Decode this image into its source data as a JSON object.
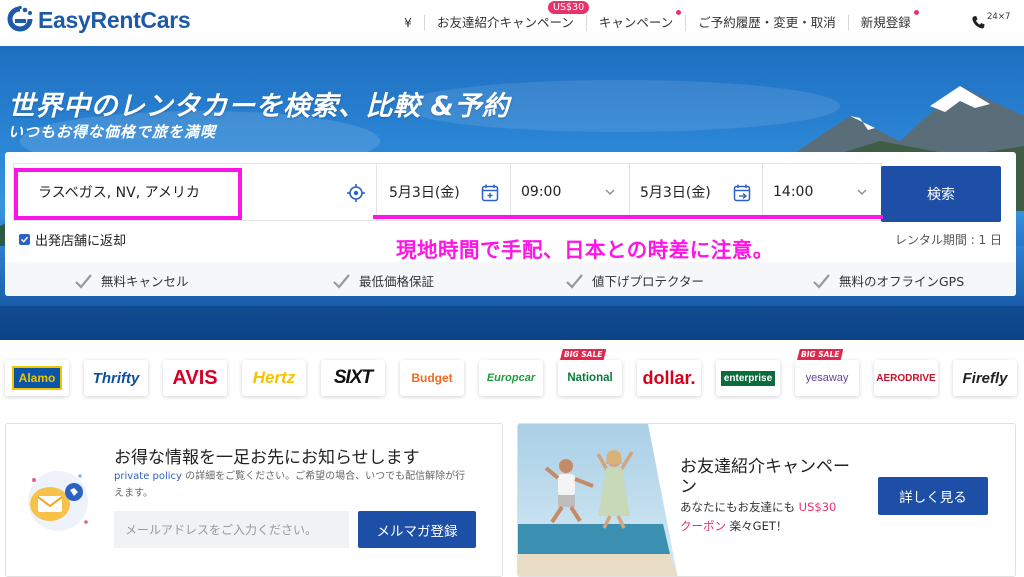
{
  "header": {
    "logo_text": "EasyRentCars",
    "nav": [
      {
        "label": "¥"
      },
      {
        "label": "お友達紹介キャンペーン"
      },
      {
        "label": "キャンペーン"
      },
      {
        "label": "ご予約履歴・変更・取消"
      },
      {
        "label": "新規登録"
      }
    ],
    "referral_badge": "US$30",
    "phone_label": "24×7"
  },
  "hero": {
    "title": "世界中のレンタカーを検索、比較 &予約",
    "subtitle": "いつもお得な価格で旅を満喫"
  },
  "search": {
    "location": "ラスベガス, NV, アメリカ",
    "pickup_date": "5月3日(金)",
    "pickup_time": "09:00",
    "return_date": "5月3日(金)",
    "return_time": "14:00",
    "search_label": "検索",
    "same_return_label": "出発店舗に返却",
    "rental_period": "レンタル期間 : 1 日"
  },
  "annotation": {
    "text": "現地時間で手配、日本との時差に注意。",
    "color": "#ff14e8"
  },
  "features": [
    {
      "label": "無料キャンセル"
    },
    {
      "label": "最低価格保証"
    },
    {
      "label": "値下げプロテクター"
    },
    {
      "label": "無料のオフラインGPS"
    }
  ],
  "brands": [
    {
      "name": "Alamo"
    },
    {
      "name": "Thrifty"
    },
    {
      "name": "AVIS"
    },
    {
      "name": "Hertz"
    },
    {
      "name": "SIXT"
    },
    {
      "name": "Budget"
    },
    {
      "name": "Europcar"
    },
    {
      "name": "National",
      "badge": "BIG SALE"
    },
    {
      "name": "dollar."
    },
    {
      "name": "enterprise"
    },
    {
      "name": "yesaway",
      "badge": "BIG SALE"
    },
    {
      "name": "AERODRIVE"
    },
    {
      "name": "Firefly"
    }
  ],
  "newsletter": {
    "title": "お得な情報を一足お先にお知らせします",
    "desc_link": "private policy",
    "desc_rest": " の詳細をご覧ください。ご希望の場合、いつでも配信解除が行えます。",
    "placeholder": "メールアドレスをご入力ください。",
    "button": "メルマガ登録"
  },
  "referral": {
    "title": "お友達紹介キャンペーン",
    "text_a": "あなたにもお友達にも ",
    "text_amount": "US$30",
    "text_coupon": "クーポン",
    "text_b": " 楽々GET！",
    "button": "詳しく見る"
  },
  "colors": {
    "brand_blue": "#1d4fa6",
    "logo_blue": "#1e5aa8",
    "accent_pink": "#e8336a"
  }
}
